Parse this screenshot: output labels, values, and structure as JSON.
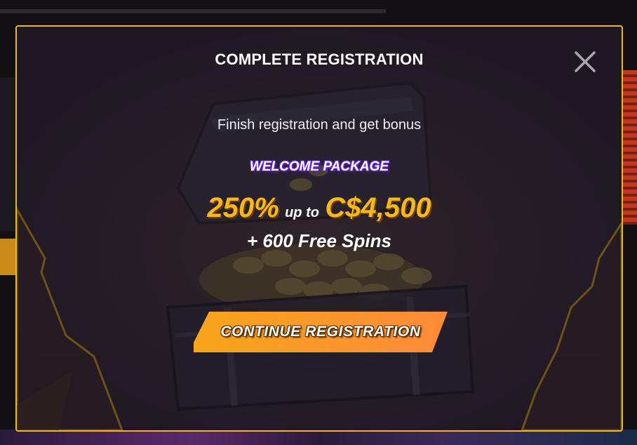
{
  "modal": {
    "title": "COMPLETE REGISTRATION",
    "close_icon": "close-icon",
    "subtitle": "Finish registration and get bonus",
    "package_label": "WELCOME PACKAGE",
    "offer": {
      "percent": "250%",
      "up_to": "up to",
      "amount": "C$4,500",
      "spins": "+ 600 Free Spins"
    },
    "cta_label": "CONTINUE REGISTRATION"
  },
  "colors": {
    "accent": "#f8b81a",
    "border": "#f2b51e",
    "modal_bg": "#211a25",
    "package_glow": "#6a2bd8",
    "cta_gradient_start": "#f7a51a",
    "cta_gradient_end": "#ff8a3a"
  },
  "icons": {
    "close": "close-icon",
    "chest": "treasure-chest-illustration"
  }
}
